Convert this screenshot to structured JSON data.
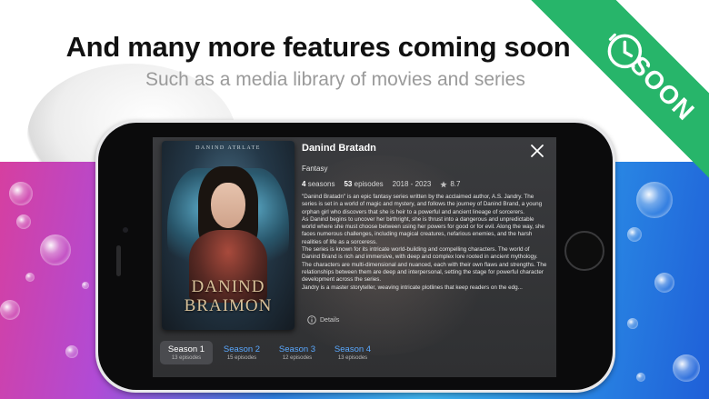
{
  "promo": {
    "headline": "And many more features coming soon",
    "subheadline": "Such as a media library of movies and series",
    "ribbon_label": "SOON",
    "ribbon_color": "#27b56a",
    "ribbon_icon": "clock-icon"
  },
  "modal": {
    "poster": {
      "top_text": "DANIND ATRLATE",
      "title_line1": "DANIND",
      "title_line2": "BRAIMON"
    },
    "title": "Danind Bratadn",
    "genre": "Fantasy",
    "seasons_count": "4",
    "seasons_label": "seasons",
    "episodes_count": "53",
    "episodes_label": "episodes",
    "years": "2018 - 2023",
    "rating": "8.7",
    "description": [
      "\"Danind Bratadn\" is an epic fantasy series written by the acclaimed author, A.S. Jandry. The series is set in a world of magic and mystery, and follows the journey of Danind Brand, a young orphan girl who discovers that she is heir to a powerful and ancient lineage of sorcerers.",
      "As Danind begins to uncover her birthright, she is thrust into a dangerous and unpredictable world where she must choose between using her powers for good or for evil. Along the way, she faces numerous challenges, including magical creatures, nefarious enemies, and the harsh realities of life as a sorceress.",
      "The series is known for its intricate world-building and compelling characters. The world of Danind Brand is rich and immersive, with deep and complex lore rooted in ancient mythology. The characters are multi-dimensional and nuanced, each with their own flaws and strengths. The relationships between them are deep and interpersonal, setting the stage for powerful character development across the series.",
      "Jandry is a master storyteller, weaving intricate plotlines that keep readers on the edg..."
    ],
    "details_label": "Details",
    "seasons": [
      {
        "label": "Season 1",
        "episodes": "13 episodes",
        "active": true
      },
      {
        "label": "Season 2",
        "episodes": "15 episodes",
        "active": false
      },
      {
        "label": "Season 3",
        "episodes": "12 episodes",
        "active": false
      },
      {
        "label": "Season 4",
        "episodes": "13 episodes",
        "active": false
      }
    ],
    "accent_color": "#5aa9ff"
  }
}
